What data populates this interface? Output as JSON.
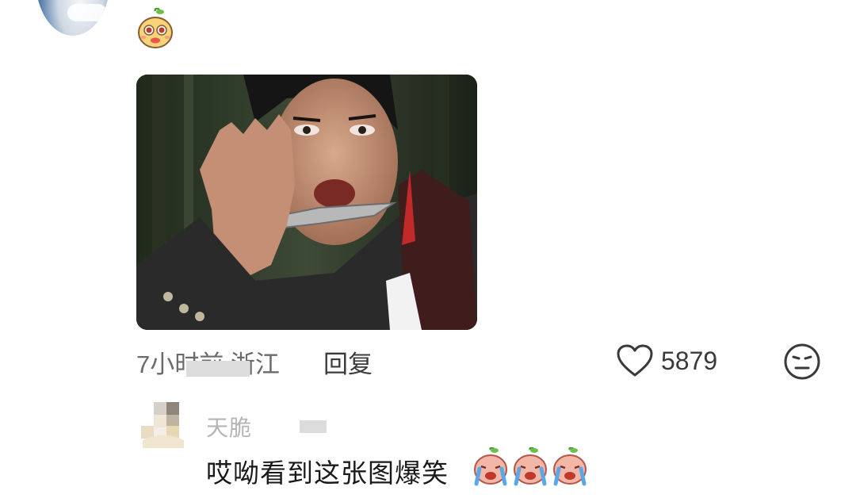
{
  "comment": {
    "time_location": "7小时前 浙江",
    "reply_label": "回复",
    "like_count": "5879",
    "avatar_icon": "sky-cloud-avatar-icon",
    "sticker_icon": "cute-blob-emoji-icon",
    "image_icon": "movie-still-photo"
  },
  "reply": {
    "username": "天脆",
    "text": "哎呦看到这张图爆笑",
    "emoji_icon": "crying-laughing-emoji-icon",
    "emoji_count": 3
  },
  "colors": {
    "text_primary": "#1a1a1a",
    "text_secondary": "#6b6b6b",
    "icon_stroke": "#3a3a3a"
  }
}
